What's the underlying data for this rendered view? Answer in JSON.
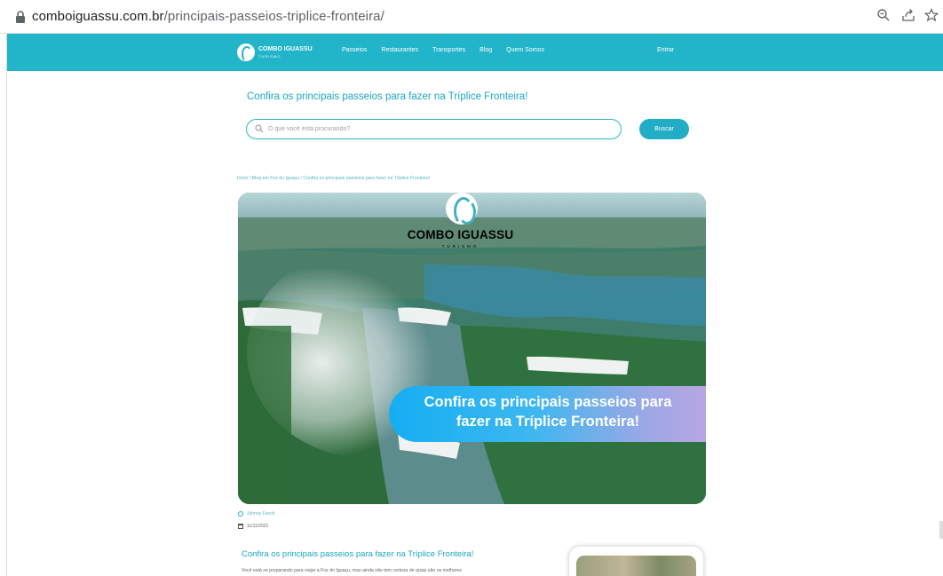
{
  "browser": {
    "url_host": "comboiguassu.com.br",
    "url_path": "/principais-passeios-triplice-fronteira/"
  },
  "site": {
    "logo_name": "COMBO IGUASSU",
    "logo_sub": "TURISMO",
    "menu": [
      "Passeios",
      "Restaurantes",
      "Transportes",
      "Blog",
      "Quem Somos"
    ],
    "login": "Entrar"
  },
  "page": {
    "headline": "Confira os principais passeios para fazer na Tríplice Fronteira!",
    "search_placeholder": "O que você está procurando?",
    "search_button": "Buscar",
    "breadcrumb": "Início / Blog em Foz do Iguaçu / Confira os principais passeios para fazer na Tríplice Fronteira!"
  },
  "hero": {
    "brand_name": "COMBO IGUASSU",
    "brand_sub": "TURISMO",
    "banner_line1": "Confira os principais passeios para",
    "banner_line2": "fazer na Tríplice Fronteira!"
  },
  "meta": {
    "author": "Johnny Fanch",
    "date": "11/11/2021"
  },
  "article": {
    "title": "Confira os principais passeios para fazer na Tríplice Fronteira!",
    "intro": "Você está se preparando para viajar a Foz do Iguaçu, mas ainda não tem certeza de quais são os melhores"
  },
  "colors": {
    "brand": "#22b5c9",
    "text_accent": "#1ba7c0"
  }
}
